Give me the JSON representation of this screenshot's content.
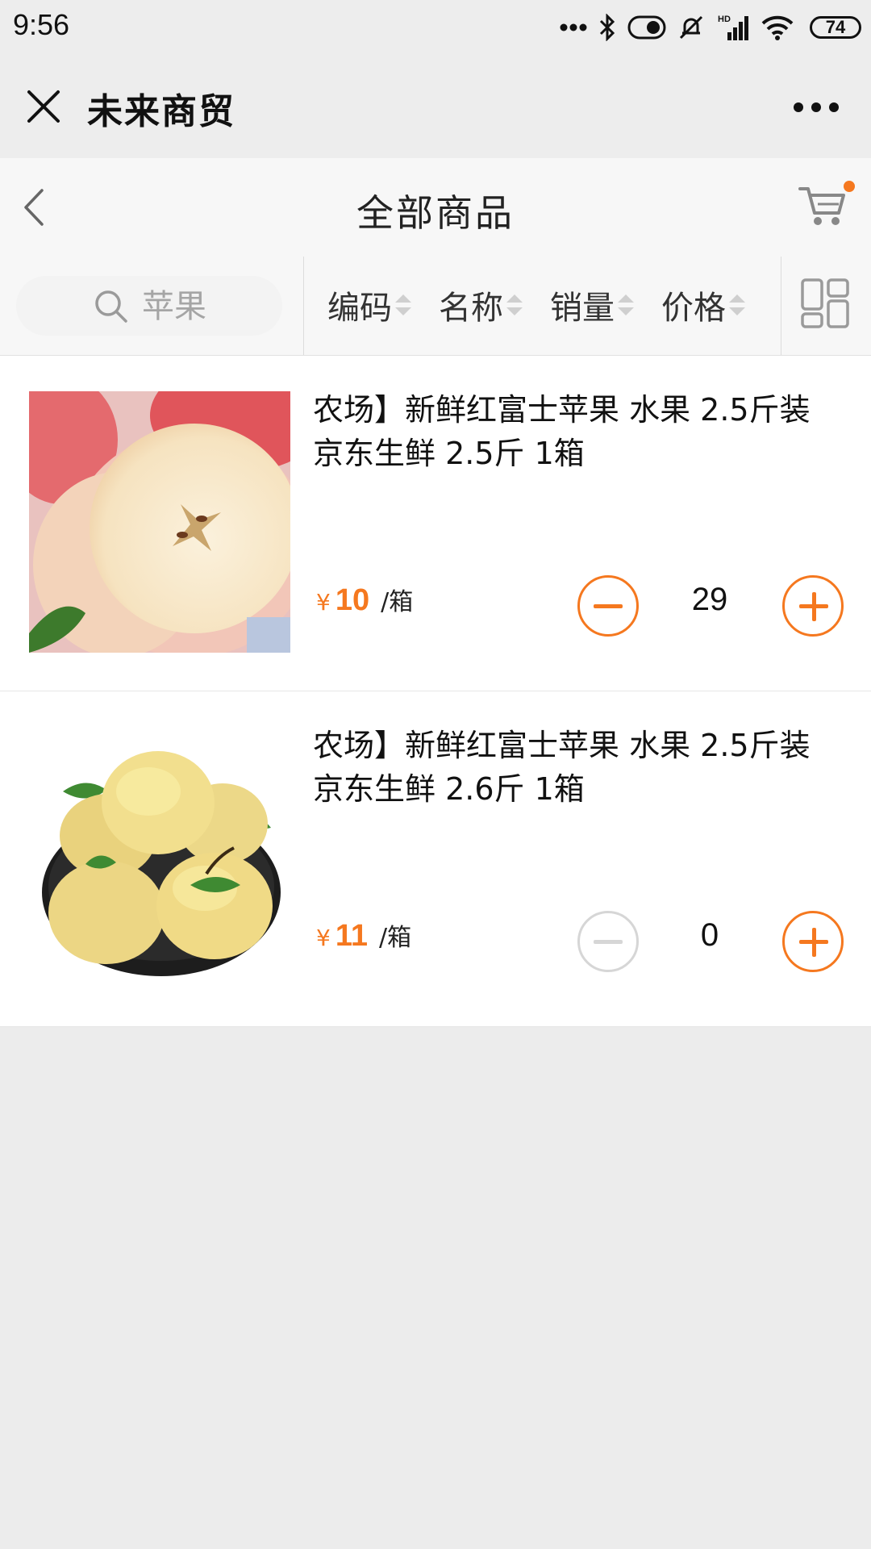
{
  "status_bar": {
    "time": "9:56",
    "battery": "74",
    "icons": [
      "more-dots-icon",
      "bluetooth-icon",
      "toggle-icon",
      "mute-bell-icon",
      "hd-signal-icon",
      "wifi-icon",
      "battery-icon"
    ]
  },
  "miniapp_bar": {
    "title": "未来商贸",
    "close_icon": "close-icon",
    "more_icon": "more-dots-icon"
  },
  "nav": {
    "title": "全部商品",
    "back_icon": "chevron-left-icon",
    "cart_icon": "cart-icon",
    "cart_badge_color": "#f5781f"
  },
  "filter": {
    "search_placeholder": "苹果",
    "sort_options": [
      "编码",
      "名称",
      "销量",
      "价格"
    ],
    "view_toggle_icon": "grid-view-icon"
  },
  "products": [
    {
      "name": "农场】新鲜红富士苹果 水果 2.5斤装 京东生鲜 2.5斤 1箱",
      "price_symbol": "¥",
      "price": "10",
      "unit": "/箱",
      "quantity": "29",
      "minus_enabled": true
    },
    {
      "name": "农场】新鲜红富士苹果 水果 2.5斤装 京东生鲜 2.6斤 1箱",
      "price_symbol": "¥",
      "price": "11",
      "unit": "/箱",
      "quantity": "0",
      "minus_enabled": false
    }
  ],
  "colors": {
    "accent": "#f5781f",
    "background": "#ececec",
    "card": "#ffffff"
  }
}
